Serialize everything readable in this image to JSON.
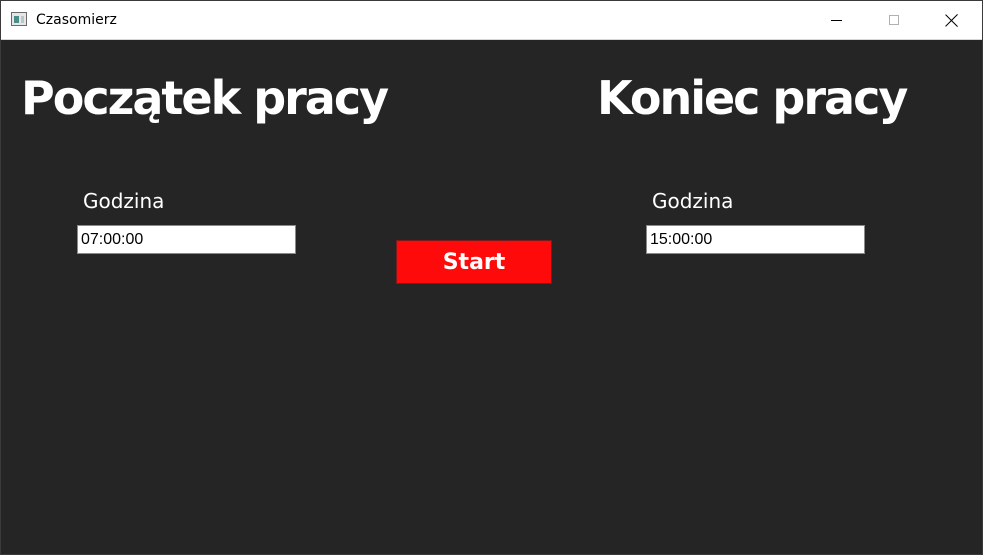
{
  "window": {
    "title": "Czasomierz",
    "icon": "app-window-icon",
    "controls": [
      "minimize-icon",
      "maximize-icon",
      "close-icon"
    ]
  },
  "start_section": {
    "heading": "Początek pracy",
    "hour_label": "Godzina",
    "hour_value": "07:00:00"
  },
  "end_section": {
    "heading": "Koniec pracy",
    "hour_label": "Godzina",
    "hour_value": "15:00:00"
  },
  "start_button": {
    "label": "Start",
    "color": "#ff0a0a"
  },
  "colors": {
    "background": "#252525",
    "text": "#ffffff",
    "titlebar": "#ffffff"
  }
}
